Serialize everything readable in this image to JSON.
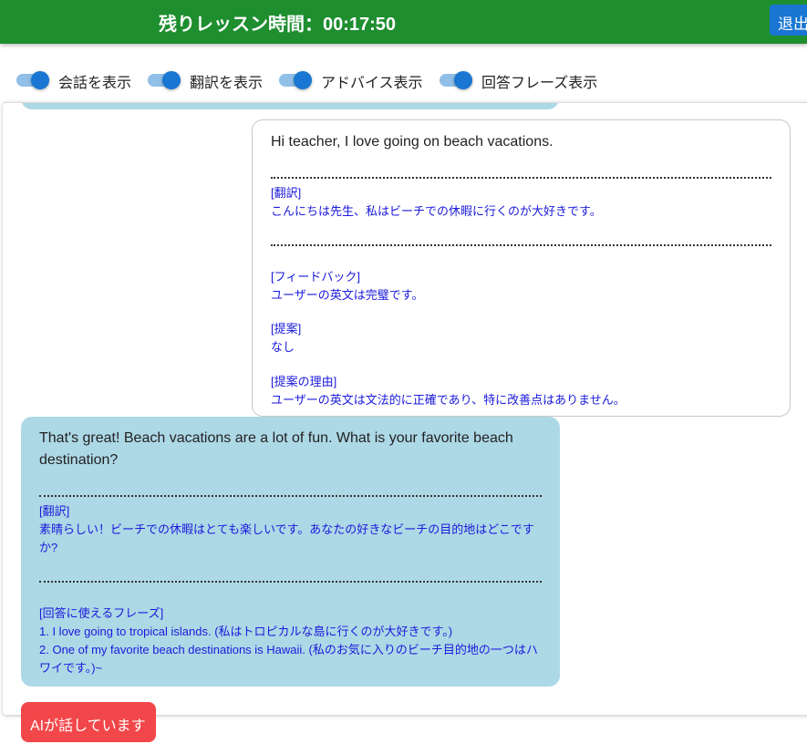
{
  "header": {
    "timer_label": "残りレッスン時間：00:17:50",
    "exit_label": "退出"
  },
  "toggles": [
    {
      "label": "会話を表示",
      "checked": true
    },
    {
      "label": "翻訳を表示",
      "checked": true
    },
    {
      "label": "アドバイス表示",
      "checked": true
    },
    {
      "label": "回答フレーズ表示",
      "checked": true
    }
  ],
  "messages": {
    "user": {
      "text": "Hi teacher, I love going on beach vacations.",
      "translation_title": "[翻訳]",
      "translation": "こんにちは先生、私はビーチでの休暇に行くのが大好きです。",
      "feedback_title": "[フィードバック]",
      "feedback": "ユーザーの英文は完璧です。",
      "suggestion_title": "[提案]",
      "suggestion": "なし",
      "reason_title": "[提案の理由]",
      "reason": "ユーザーの英文は文法的に正確であり、特に改善点はありません。"
    },
    "ai": {
      "text": "That's great! Beach vacations are a lot of fun. What is your favorite beach destination?",
      "translation_title": "[翻訳]",
      "translation": "素晴らしい！ビーチでの休暇はとても楽しいです。あなたの好きなビーチの目的地はどこですか?",
      "phrases_title": "[回答に使えるフレーズ]",
      "phrase_1": "1. I love going to tropical islands. (私はトロピカルな島に行くのが大好きです。)",
      "phrase_2": "2. One of my favorite beach destinations is Hawaii. (私のお気に入りのビーチ目的地の一つはハワイです。)~"
    }
  },
  "status": {
    "label": "AIが話しています"
  },
  "colors": {
    "header_bg": "#1e8e2f",
    "accent": "#1976d2",
    "ai_bubble": "#add8e6",
    "status_bg": "#f2474a",
    "annotation_text": "#1a1adb"
  }
}
